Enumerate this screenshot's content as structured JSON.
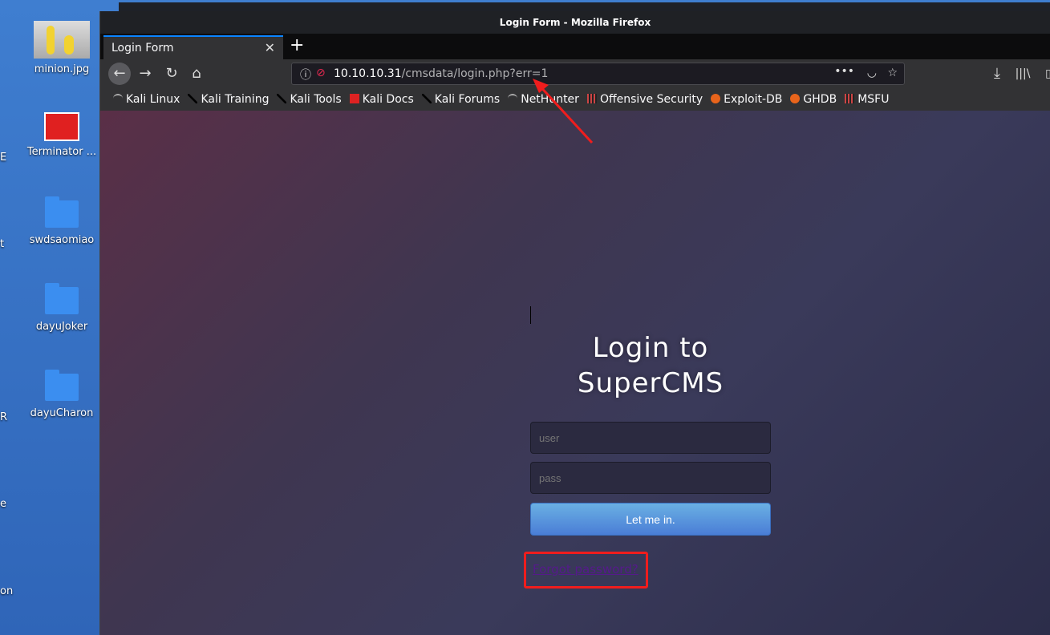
{
  "desktop": {
    "icons": [
      {
        "label": "minion.jpg"
      },
      {
        "label": "Terminator ..."
      },
      {
        "label": "swdsaomiao"
      },
      {
        "label": "dayuJoker"
      },
      {
        "label": "dayuCharon"
      }
    ],
    "edge_labels": [
      "E",
      "t",
      "R",
      "e",
      "on"
    ]
  },
  "window": {
    "title": "Login Form - Mozilla Firefox"
  },
  "tab": {
    "label": "Login Form"
  },
  "url": {
    "host": "10.10.10.31",
    "path": "/cmsdata/login.php?err=1"
  },
  "bookmarks": [
    "Kali Linux",
    "Kali Training",
    "Kali Tools",
    "Kali Docs",
    "Kali Forums",
    "NetHunter",
    "Offensive Security",
    "Exploit-DB",
    "GHDB",
    "MSFU"
  ],
  "login": {
    "title_line1": "Login to",
    "title_line2": "SuperCMS",
    "user_placeholder": "user",
    "pass_placeholder": "pass",
    "submit": "Let me in.",
    "forgot": "Forgot password?"
  },
  "colors": {
    "annotation": "#f01d1d",
    "button": "#5a94dc"
  }
}
